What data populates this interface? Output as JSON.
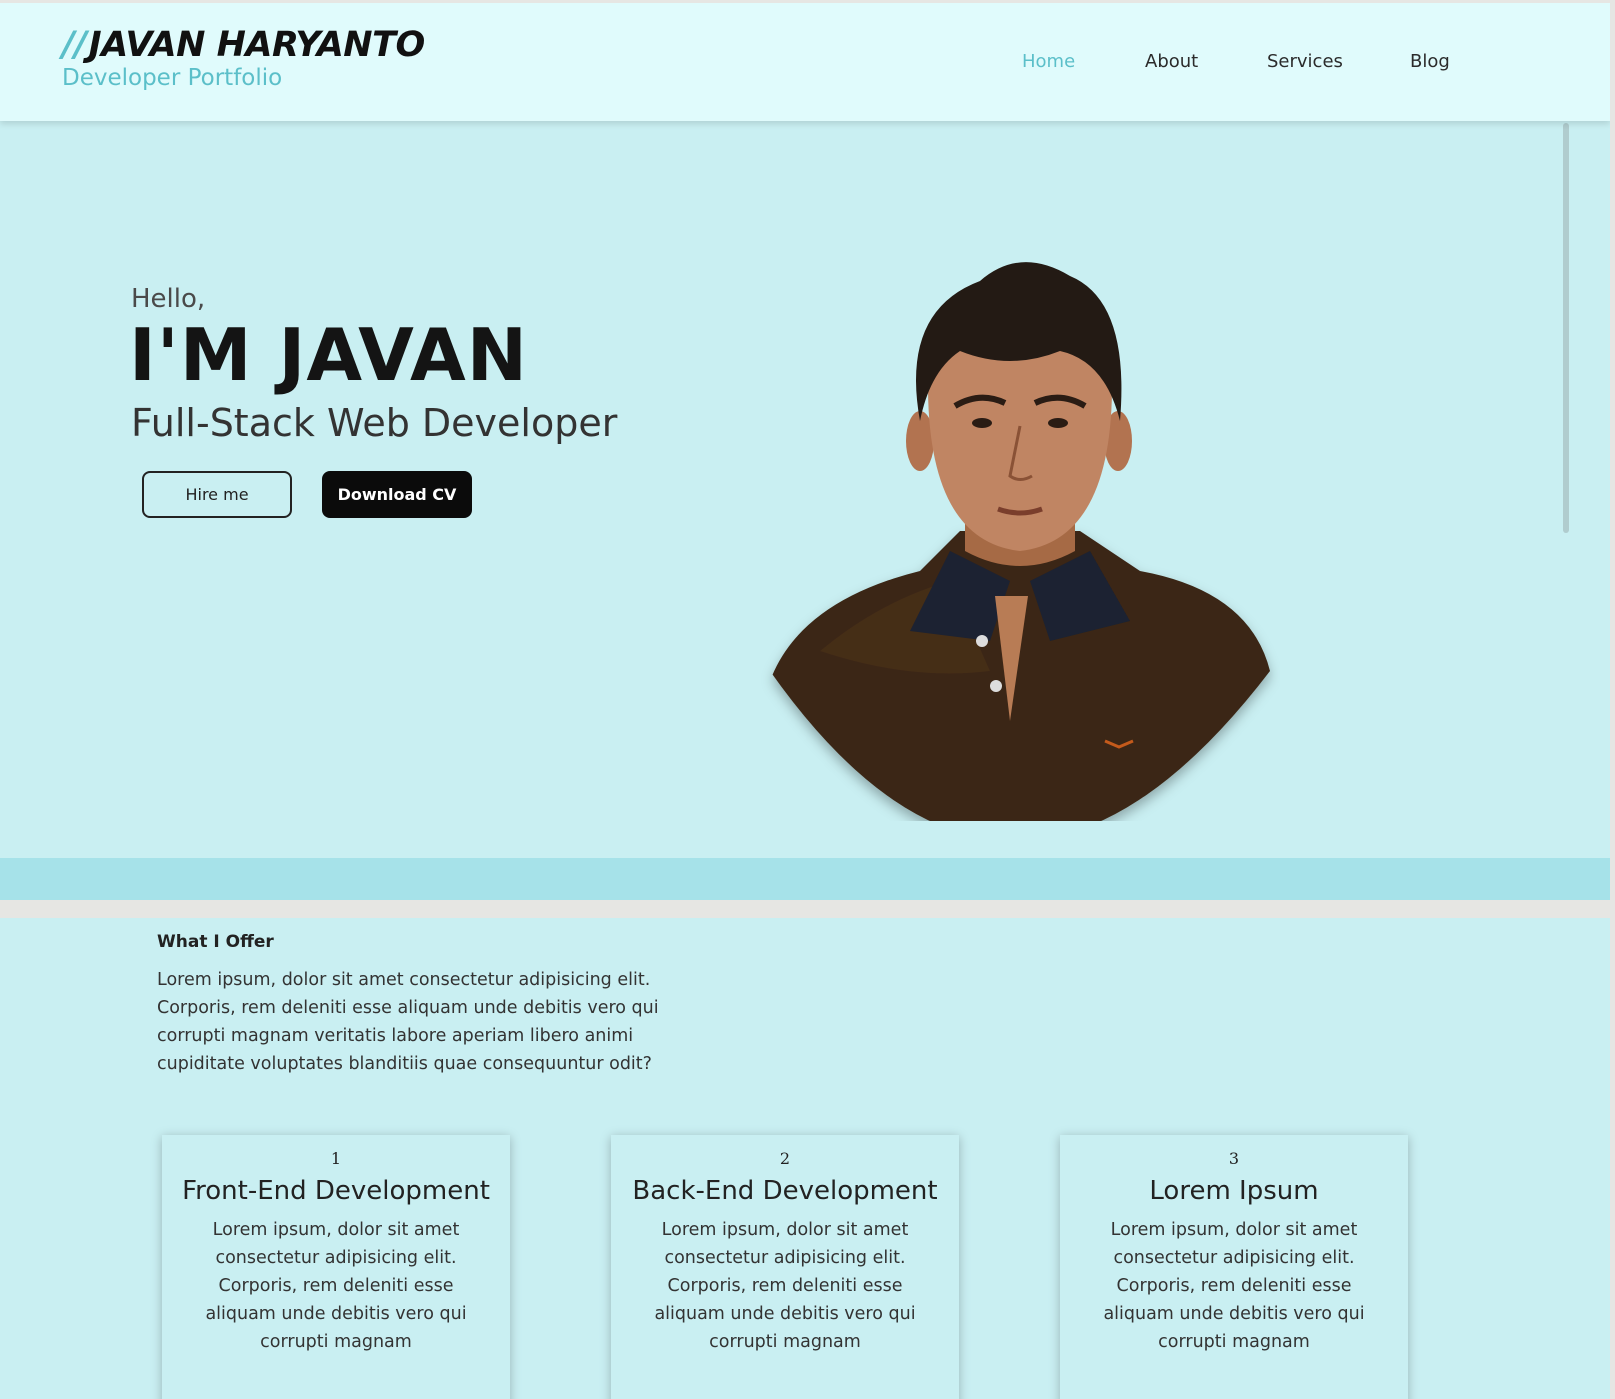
{
  "header": {
    "brand_prefix": "//",
    "brand_title": "JAVAN HARYANTO",
    "brand_subtitle": "Developer Portfolio",
    "nav": [
      {
        "label": "Home",
        "active": true
      },
      {
        "label": "About",
        "active": false
      },
      {
        "label": "Services",
        "active": false
      },
      {
        "label": "Blog",
        "active": false
      }
    ]
  },
  "hero": {
    "greeting": "Hello,",
    "name": "I'M JAVAN",
    "role": "Full-Stack Web Developer",
    "hire_button": "Hire me",
    "cv_button": "Download CV"
  },
  "services": {
    "label": "What I Offer",
    "intro": "Lorem ipsum, dolor sit amet consectetur adipisicing elit. Corporis, rem deleniti esse aliquam unde debitis vero qui corrupti magnam veritatis labore aperiam libero animi cupiditate voluptates blanditiis quae consequuntur odit?",
    "cards": [
      {
        "number": "1",
        "title": "Front-End Development",
        "text": "Lorem ipsum, dolor sit amet consectetur adipisicing elit. Corporis, rem deleniti esse aliquam unde debitis vero qui corrupti magnam"
      },
      {
        "number": "2",
        "title": "Back-End Development",
        "text": "Lorem ipsum, dolor sit amet consectetur adipisicing elit. Corporis, rem deleniti esse aliquam unde debitis vero qui corrupti magnam"
      },
      {
        "number": "3",
        "title": "Lorem Ipsum",
        "text": "Lorem ipsum, dolor sit amet consectetur adipisicing elit. Corporis, rem deleniti esse aliquam unde debitis vero qui corrupti magnam"
      }
    ]
  },
  "colors": {
    "accent": "#5bbfc9",
    "header_bg": "#e0fbfc",
    "hero_bg": "#c9eff2",
    "strip_bg": "#a6e2e9",
    "button_dark": "#0b0b0b"
  }
}
